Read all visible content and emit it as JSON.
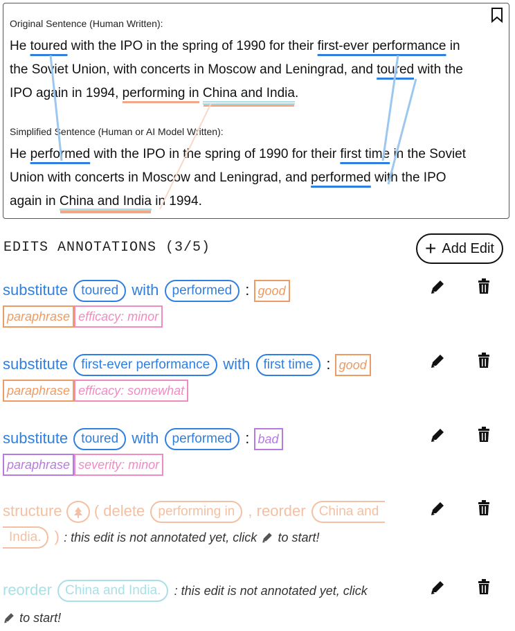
{
  "card": {
    "original_caption": "Original Sentence (Human Written):",
    "simplified_caption": "Simplified Sentence (Human or AI Model Written):",
    "original": {
      "l1a": "He ",
      "l1_toured": "toured",
      "l1b": " with the IPO in the spring of 1990 for their ",
      "l1_fe": "first-ever performance",
      "l1c": " in",
      "l2a": "the Soviet Union, with concerts in Moscow and Leningrad, and ",
      "l2_toured": "toured",
      "l2b": " with the",
      "l3a": "IPO again in 1994, ",
      "l3_perf": "performing in",
      "l3_sp": " ",
      "l3_ci": "China and India",
      "l3b": "."
    },
    "simplified": {
      "l1a": "He ",
      "l1_perf": "performed",
      "l1b": " with the IPO in the spring of 1990 for their ",
      "l1_ft": "first time",
      "l1c": " in the Soviet",
      "l2a": "Union with concerts in Moscow and Leningrad, and ",
      "l2_perf": "performed",
      "l2b": " with the IPO",
      "l3a": "again in ",
      "l3_ci": "China and India",
      "l3b": " in 1994."
    }
  },
  "section_title": "EDITS ANNOTATIONS (3/5)",
  "add_edit_label": "Add Edit",
  "edits": [
    {
      "op": "substitute",
      "from": "toured",
      "with": "with",
      "to": "performed",
      "colon": ":",
      "quality": "good",
      "type": "paraphrase",
      "rating": "efficacy: minor"
    },
    {
      "op": "substitute",
      "from": "first-ever performance",
      "with": "with",
      "to": "first time",
      "colon": ":",
      "quality": "good",
      "type": "paraphrase",
      "rating": "efficacy: somewhat"
    },
    {
      "op": "substitute",
      "from": "toured",
      "with": "with",
      "to": "performed",
      "colon": ":",
      "quality": "bad",
      "type": "paraphrase",
      "rating": "severity: minor"
    },
    {
      "op": "structure",
      "open": "(",
      "sub1": "delete",
      "sub1_pill": "performing in",
      "sep": ",",
      "sub2": "reorder",
      "sub2_pill_a": "China and",
      "sub2_pill_b": "India.",
      "close": ")",
      "note_a": ": this edit is not annotated yet, click",
      "note_b": "to start!"
    },
    {
      "op": "reorder",
      "pill": "China and India.",
      "note_a": ": this edit is not annotated yet, click",
      "note_b": "to start!"
    }
  ],
  "colors": {
    "blue": "#2f7fe0",
    "orange": "#ee9b63",
    "pink": "#f08bc2",
    "purple": "#b57be0",
    "peach": "#f3c0a3",
    "cyan": "#a9dfe6"
  }
}
